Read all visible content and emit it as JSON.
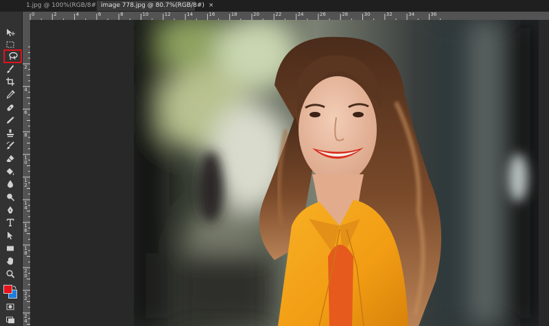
{
  "tabs": [
    {
      "label": "1.jpg @ 100%(RGB/8#)",
      "close": "×",
      "active": false
    },
    {
      "label": "image 778.jpg @ 80.7%(RGB/8#)",
      "close": "×",
      "active": true
    }
  ],
  "rulers": {
    "horizontal": [
      "0",
      "2",
      "4",
      "6",
      "8",
      "10",
      "12",
      "14",
      "16",
      "18",
      "20",
      "22",
      "24",
      "26",
      "28",
      "30",
      "32",
      "34",
      "36"
    ],
    "vertical": [
      "2",
      "4",
      "6",
      "8",
      "1\n0",
      "1\n2",
      "1\n4",
      "1\n6",
      "1\n8",
      "2\n0",
      "2\n2",
      "2\n4"
    ]
  },
  "tools": [
    "move-tool-icon",
    "marquee-tool-icon",
    "lasso-tool-icon",
    "brush-tool-icon",
    "crop-tool-icon",
    "eyedropper-tool-icon",
    "healing-tool-icon",
    "pencil-tool-icon",
    "stamp-tool-icon",
    "history-brush-icon",
    "eraser-tool-icon",
    "paint-bucket-icon",
    "blur-tool-icon",
    "dodge-tool-icon",
    "pen-tool-icon",
    "type-tool-icon",
    "path-select-icon",
    "rectangle-tool-icon",
    "hand-tool-icon",
    "zoom-tool-icon"
  ],
  "colors": {
    "foreground": "#e8121c",
    "background": "#1c7fe0",
    "highlight": "#e0141b",
    "blazer": "#f4a51c"
  }
}
